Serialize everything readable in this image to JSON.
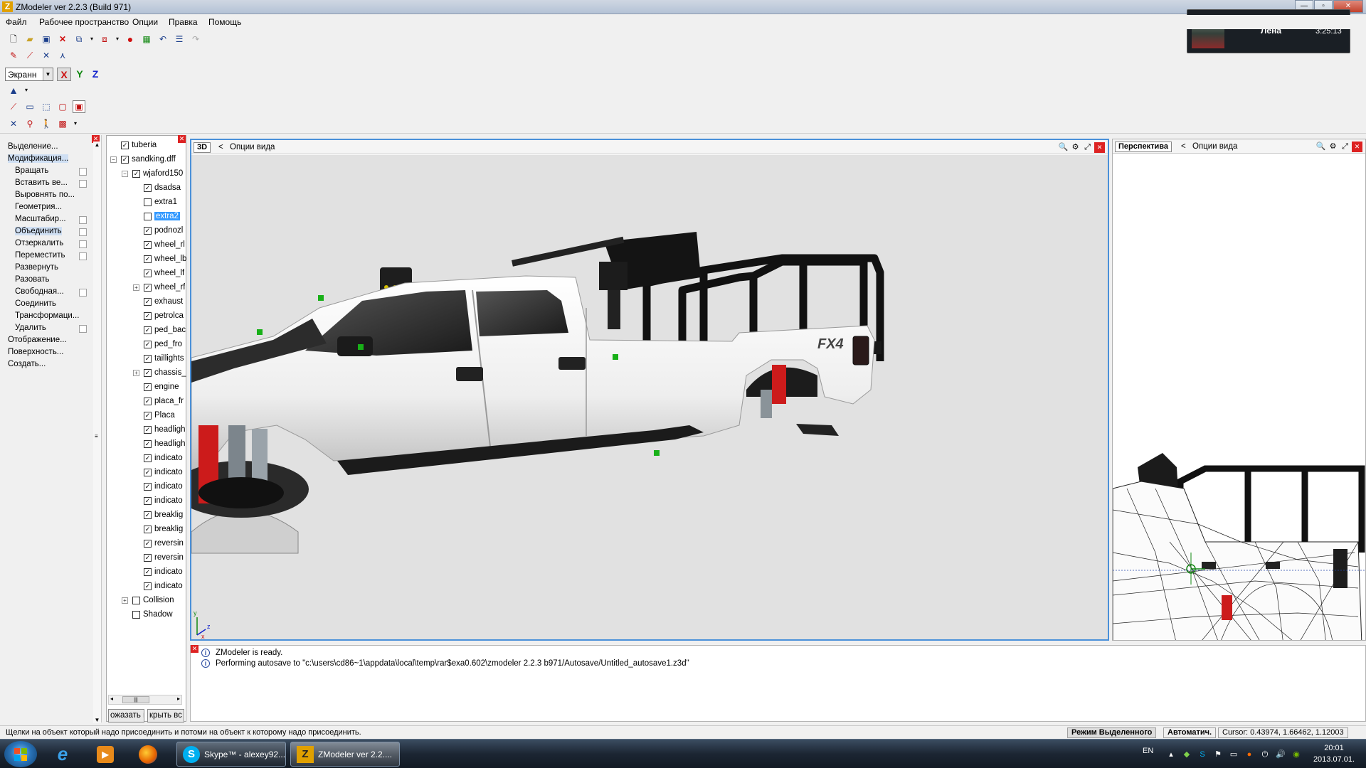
{
  "window": {
    "title": "ZModeler ver 2.2.3 (Build 971)",
    "logo": "Z",
    "buttons": [
      "minimize",
      "maximize",
      "close"
    ]
  },
  "skype_popup": {
    "name": "Лена",
    "time": "3:25:13"
  },
  "menu": [
    "Файл",
    "Рабочее пространство",
    "Опции",
    "Правка",
    "Помощь"
  ],
  "toolbar": {
    "row1_icons": [
      "new-file-icon",
      "open-file-icon",
      "save-icon",
      "delete-icon",
      "import-icon",
      "export-icon",
      "record-icon",
      "render-icon",
      "undo-icon",
      "properties-icon",
      "redo-icon"
    ],
    "coord_system": "Экранн",
    "axes": {
      "x": "X",
      "y": "Y",
      "z": "Z",
      "x_color": "#cc1111",
      "y_color": "#118811",
      "z_color": "#1122cc"
    }
  },
  "left_panel": {
    "commands": [
      {
        "label": "Выделение...",
        "level": "top",
        "checkbox": false,
        "selected": false
      },
      {
        "label": "Модификация...",
        "level": "top",
        "checkbox": false,
        "selected": true
      },
      {
        "label": "Вращать",
        "level": "sub",
        "checkbox": true,
        "selected": false
      },
      {
        "label": "Вставить ве...",
        "level": "sub",
        "checkbox": true,
        "selected": false
      },
      {
        "label": "Выровнять по...",
        "level": "sub",
        "checkbox": false,
        "selected": false
      },
      {
        "label": "Геометрия...",
        "level": "sub",
        "checkbox": false,
        "selected": false
      },
      {
        "label": "Масштабир...",
        "level": "sub",
        "checkbox": true,
        "selected": false
      },
      {
        "label": "Объединить",
        "level": "sub",
        "checkbox": true,
        "selected": true
      },
      {
        "label": "Отзеркалить",
        "level": "sub",
        "checkbox": true,
        "selected": false
      },
      {
        "label": "Переместить",
        "level": "sub",
        "checkbox": true,
        "selected": false
      },
      {
        "label": "Развернуть",
        "level": "sub",
        "checkbox": false,
        "selected": false
      },
      {
        "label": "Разовать",
        "level": "sub",
        "checkbox": false,
        "selected": false
      },
      {
        "label": "Свободная...",
        "level": "sub",
        "checkbox": true,
        "selected": false
      },
      {
        "label": "Соединить",
        "level": "sub",
        "checkbox": false,
        "selected": false
      },
      {
        "label": "Трансформаци...",
        "level": "sub",
        "checkbox": false,
        "selected": false
      },
      {
        "label": "Удалить",
        "level": "sub",
        "checkbox": true,
        "selected": false
      },
      {
        "label": "Отображение...",
        "level": "top",
        "checkbox": false,
        "selected": false
      },
      {
        "label": "Поверхность...",
        "level": "top",
        "checkbox": false,
        "selected": false
      },
      {
        "label": "Создать...",
        "level": "top",
        "checkbox": false,
        "selected": false
      }
    ]
  },
  "hierarchy": {
    "nodes": [
      {
        "label": "tuberia",
        "depth": 0,
        "checked": true,
        "expander": "",
        "selected": false
      },
      {
        "label": "sandking.dff",
        "depth": 0,
        "checked": true,
        "expander": "−",
        "selected": false
      },
      {
        "label": "wjaford150",
        "depth": 1,
        "checked": true,
        "expander": "−",
        "selected": false
      },
      {
        "label": "dsadsa",
        "depth": 2,
        "checked": true,
        "expander": "",
        "selected": false
      },
      {
        "label": "extra1",
        "depth": 2,
        "checked": false,
        "expander": "",
        "selected": false
      },
      {
        "label": "extra2",
        "depth": 2,
        "checked": false,
        "expander": "",
        "selected": true
      },
      {
        "label": "podnozl",
        "depth": 2,
        "checked": true,
        "expander": "",
        "selected": false
      },
      {
        "label": "wheel_rl",
        "depth": 2,
        "checked": true,
        "expander": "",
        "selected": false
      },
      {
        "label": "wheel_lb",
        "depth": 2,
        "checked": true,
        "expander": "",
        "selected": false
      },
      {
        "label": "wheel_lf",
        "depth": 2,
        "checked": true,
        "expander": "",
        "selected": false
      },
      {
        "label": "wheel_rf",
        "depth": 2,
        "checked": true,
        "expander": "+",
        "selected": false
      },
      {
        "label": "exhaust",
        "depth": 2,
        "checked": true,
        "expander": "",
        "selected": false
      },
      {
        "label": "petrolca",
        "depth": 2,
        "checked": true,
        "expander": "",
        "selected": false
      },
      {
        "label": "ped_bac",
        "depth": 2,
        "checked": true,
        "expander": "",
        "selected": false
      },
      {
        "label": "ped_fro",
        "depth": 2,
        "checked": true,
        "expander": "",
        "selected": false
      },
      {
        "label": "taillights",
        "depth": 2,
        "checked": true,
        "expander": "",
        "selected": false
      },
      {
        "label": "chassis_",
        "depth": 2,
        "checked": true,
        "expander": "+",
        "selected": false
      },
      {
        "label": "engine",
        "depth": 2,
        "checked": true,
        "expander": "",
        "selected": false
      },
      {
        "label": "placa_fr",
        "depth": 2,
        "checked": true,
        "expander": "",
        "selected": false
      },
      {
        "label": "Placa",
        "depth": 2,
        "checked": true,
        "expander": "",
        "selected": false
      },
      {
        "label": "headligh",
        "depth": 2,
        "checked": true,
        "expander": "",
        "selected": false
      },
      {
        "label": "headligh",
        "depth": 2,
        "checked": true,
        "expander": "",
        "selected": false
      },
      {
        "label": "indicato",
        "depth": 2,
        "checked": true,
        "expander": "",
        "selected": false
      },
      {
        "label": "indicato",
        "depth": 2,
        "checked": true,
        "expander": "",
        "selected": false
      },
      {
        "label": "indicato",
        "depth": 2,
        "checked": true,
        "expander": "",
        "selected": false
      },
      {
        "label": "indicato",
        "depth": 2,
        "checked": true,
        "expander": "",
        "selected": false
      },
      {
        "label": "breaklig",
        "depth": 2,
        "checked": true,
        "expander": "",
        "selected": false
      },
      {
        "label": "breaklig",
        "depth": 2,
        "checked": true,
        "expander": "",
        "selected": false
      },
      {
        "label": "reversin",
        "depth": 2,
        "checked": true,
        "expander": "",
        "selected": false
      },
      {
        "label": "reversin",
        "depth": 2,
        "checked": true,
        "expander": "",
        "selected": false
      },
      {
        "label": "indicato",
        "depth": 2,
        "checked": true,
        "expander": "",
        "selected": false
      },
      {
        "label": "indicato",
        "depth": 2,
        "checked": true,
        "expander": "",
        "selected": false
      },
      {
        "label": "Collision",
        "depth": 1,
        "checked": false,
        "expander": "+",
        "selected": false
      },
      {
        "label": "Shadow",
        "depth": 1,
        "checked": false,
        "expander": "",
        "selected": false
      }
    ],
    "show_button": "ожазать в",
    "hide_button": "крыть вс"
  },
  "viewport_main": {
    "mode_label": "3D",
    "options_label": "Опции вида",
    "badge": "FX4",
    "axis_y": "y",
    "axis_z": "z",
    "axis_x": "x"
  },
  "viewport_side": {
    "mode_label": "Перспектива",
    "options_label": "Опции вида"
  },
  "log": [
    "ZModeler is ready.",
    "Performing autosave to \"c:\\users\\cd86~1\\appdata\\local\\temp\\rar$exa0.602\\zmodeler 2.2.3 b971/Autosave/Untitled_autosave1.z3d\""
  ],
  "status": {
    "hint": "Щелки на объект который надо присоединить и потоми на объект к которому надо присоединить.",
    "mode": "Режим Выделенного",
    "auto": "Автоматич.",
    "cursor": "Cursor: 0.43974, 1.66462, 1.12003"
  },
  "taskbar": {
    "tasks": [
      {
        "label": "Skype™ - alexey92...",
        "icon": "S",
        "color": "#00aff0"
      },
      {
        "label": "ZModeler ver 2.2....",
        "icon": "Z",
        "color": "#e0a000"
      }
    ],
    "pinned": [
      "windows-start-icon",
      "ie-icon",
      "media-player-icon",
      "firefox-icon"
    ],
    "lang": "EN",
    "time": "20:01",
    "date": "2013.07.01."
  }
}
